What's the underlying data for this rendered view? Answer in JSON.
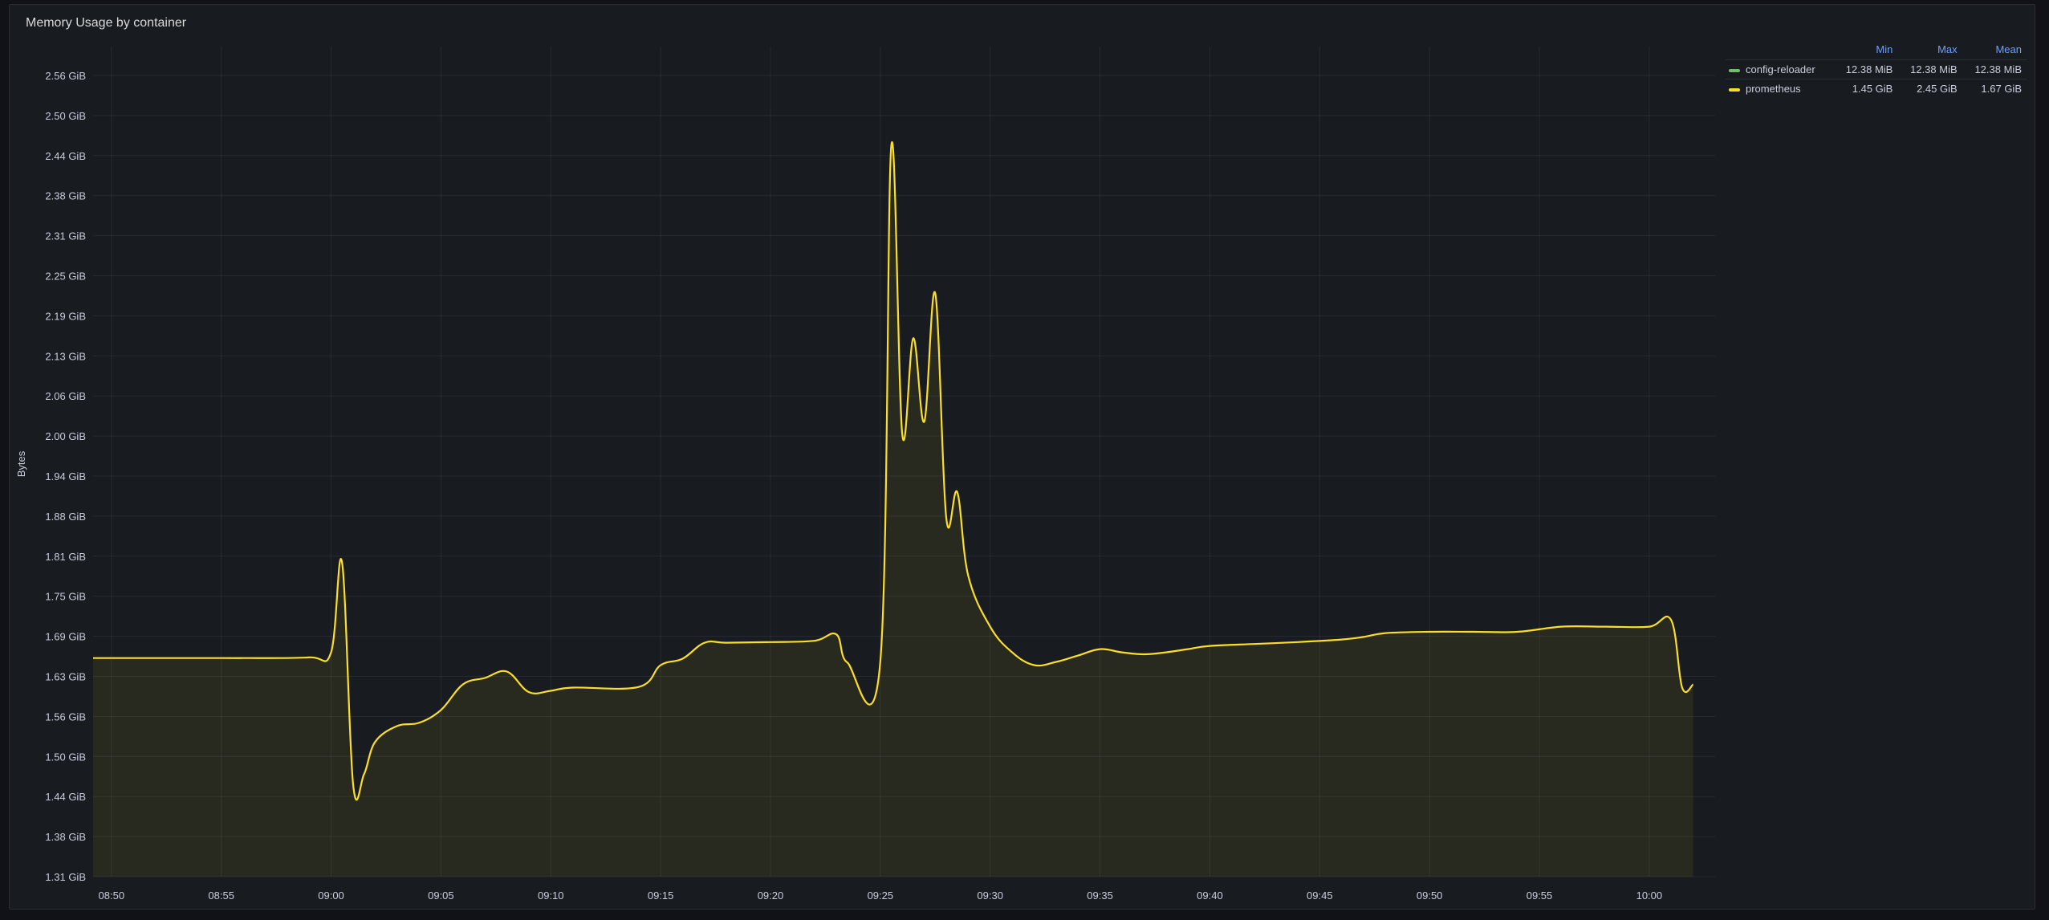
{
  "panel": {
    "title": "Memory Usage by container"
  },
  "legend": {
    "columns": [
      "Min",
      "Max",
      "Mean"
    ],
    "items": [
      {
        "name": "config-reloader",
        "color": "#73bf69",
        "min": "12.38 MiB",
        "max": "12.38 MiB",
        "mean": "12.38 MiB"
      },
      {
        "name": "prometheus",
        "color": "#fade2a",
        "min": "1.45 GiB",
        "max": "2.45 GiB",
        "mean": "1.67 GiB"
      }
    ]
  },
  "chart_data": {
    "type": "area",
    "ylabel": "Bytes",
    "y_unit": "GiB",
    "ylim": [
      1.31,
      2.56
    ],
    "y_ticks": [
      "1.31 GiB",
      "1.38 GiB",
      "1.44 GiB",
      "1.50 GiB",
      "1.56 GiB",
      "1.63 GiB",
      "1.69 GiB",
      "1.75 GiB",
      "1.81 GiB",
      "1.88 GiB",
      "1.94 GiB",
      "2.00 GiB",
      "2.06 GiB",
      "2.13 GiB",
      "2.19 GiB",
      "2.25 GiB",
      "2.31 GiB",
      "2.38 GiB",
      "2.44 GiB",
      "2.50 GiB",
      "2.56 GiB"
    ],
    "x_ticks": [
      "08:50",
      "08:55",
      "09:00",
      "09:05",
      "09:10",
      "09:15",
      "09:20",
      "09:25",
      "09:30",
      "09:35",
      "09:40",
      "09:45",
      "09:50",
      "09:55",
      "10:00"
    ],
    "grid": true,
    "legend_position": "right",
    "series": [
      {
        "name": "prometheus",
        "color": "#fade2a",
        "x": [
          "08:49",
          "08:50",
          "08:55",
          "08:56",
          "08:59",
          "09:00",
          "09:00:30",
          "09:01",
          "09:01:30",
          "09:02",
          "09:03",
          "09:04",
          "09:05",
          "09:06",
          "09:07",
          "09:08",
          "09:09",
          "09:10",
          "09:11",
          "09:14",
          "09:15",
          "09:16",
          "09:17",
          "09:18",
          "09:20",
          "09:22",
          "09:23",
          "09:23:30",
          "09:25",
          "09:25:30",
          "09:26",
          "09:26:30",
          "09:27",
          "09:27:30",
          "09:28",
          "09:28:30",
          "09:29",
          "09:30",
          "09:31",
          "09:32",
          "09:33",
          "09:34",
          "09:35",
          "09:36",
          "09:37",
          "09:38",
          "09:39",
          "09:40",
          "09:42",
          "09:44",
          "09:46",
          "09:47",
          "09:48",
          "09:50",
          "09:52",
          "09:54",
          "09:56",
          "09:58",
          "10:00",
          "10:01",
          "10:01:30",
          "10:02"
        ],
        "values": [
          1.651,
          1.651,
          1.651,
          1.651,
          1.652,
          1.66,
          1.8,
          1.455,
          1.47,
          1.52,
          1.545,
          1.55,
          1.57,
          1.61,
          1.62,
          1.63,
          1.598,
          1.6,
          1.605,
          1.606,
          1.64,
          1.65,
          1.675,
          1.675,
          1.676,
          1.678,
          1.688,
          1.644,
          1.645,
          2.45,
          2.0,
          2.15,
          2.02,
          2.22,
          1.87,
          1.91,
          1.78,
          1.7,
          1.66,
          1.64,
          1.645,
          1.655,
          1.665,
          1.66,
          1.657,
          1.66,
          1.665,
          1.67,
          1.673,
          1.676,
          1.68,
          1.684,
          1.69,
          1.692,
          1.692,
          1.692,
          1.7,
          1.7,
          1.7,
          1.71,
          1.605,
          1.61
        ]
      },
      {
        "name": "config-reloader",
        "color": "#73bf69",
        "x": [
          "08:49",
          "10:02"
        ],
        "values": [
          0.0121,
          0.0121
        ]
      }
    ]
  }
}
